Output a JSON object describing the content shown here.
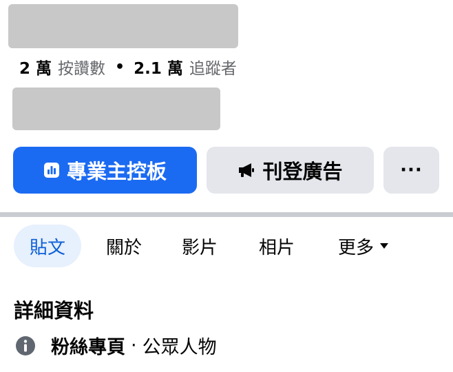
{
  "stats": {
    "likes_count": "2 萬",
    "likes_label": "按讚數",
    "separator": "•",
    "followers_count": "2.1 萬",
    "followers_label": "追蹤者"
  },
  "actions": {
    "dashboard_label": "專業主控板",
    "dashboard_icon": "bar-chart-icon",
    "advertise_label": "刊登廣告",
    "advertise_icon": "megaphone-icon",
    "more_label": "···",
    "primary_color": "#1b6bf2",
    "secondary_color": "#e4e6eb"
  },
  "tabs": [
    {
      "label": "貼文",
      "active": true
    },
    {
      "label": "關於",
      "active": false
    },
    {
      "label": "影片",
      "active": false
    },
    {
      "label": "相片",
      "active": false
    },
    {
      "label": "更多",
      "active": false
    }
  ],
  "details": {
    "title": "詳細資料",
    "info_icon": "info-icon",
    "category_main": "粉絲專頁",
    "category_separator": "·",
    "category_sub": "公眾人物"
  }
}
